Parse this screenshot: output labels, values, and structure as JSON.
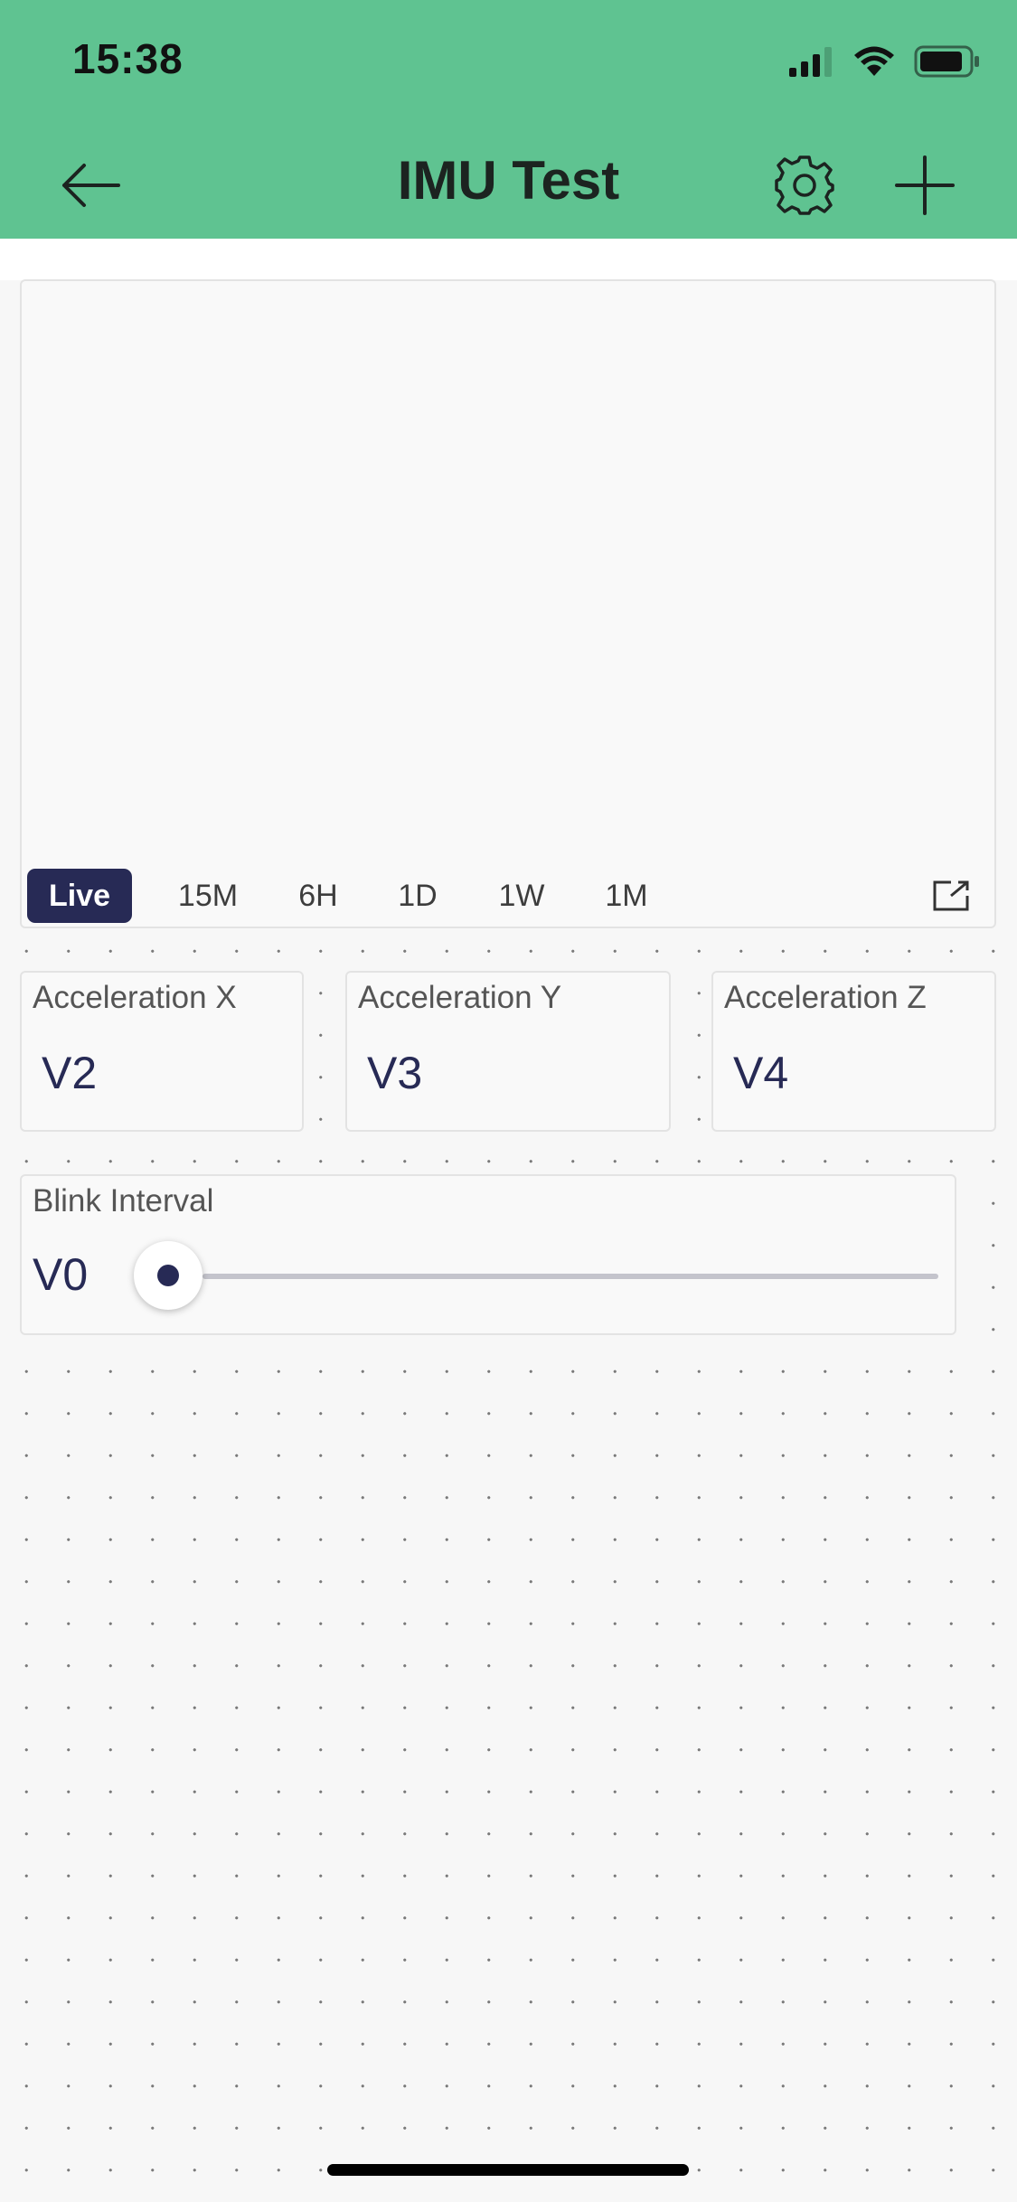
{
  "status_bar": {
    "time": "15:38"
  },
  "header": {
    "title": "IMU Test"
  },
  "chart": {
    "ranges": [
      "Live",
      "15M",
      "6H",
      "1D",
      "1W",
      "1M"
    ],
    "active_range": "Live"
  },
  "displays": [
    {
      "label": "Acceleration X",
      "value": "V2"
    },
    {
      "label": "Acceleration Y",
      "value": "V3"
    },
    {
      "label": "Acceleration Z",
      "value": "V4"
    }
  ],
  "slider": {
    "label": "Blink Interval",
    "value": "V0",
    "level": 0
  },
  "colors": {
    "header_bg": "#5fc391",
    "accent": "#272a55"
  }
}
